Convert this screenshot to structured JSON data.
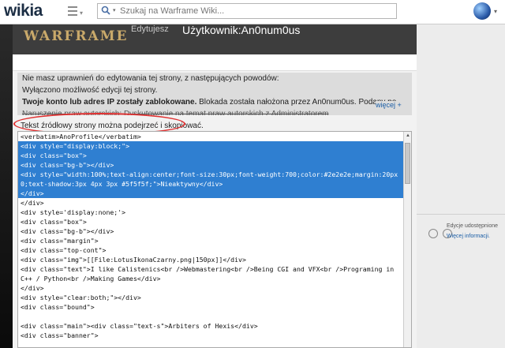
{
  "topbar": {
    "logo": "wikia",
    "search_placeholder": "Szukaj na Warframe Wiki..."
  },
  "header": {
    "site_logo": "WARFRAME",
    "editing_label": "Edytujesz",
    "page_title": "Użytkownik:An0num0us"
  },
  "notice": {
    "line1": "Nie masz uprawnień do edytowania tej strony, z następujących powodów:",
    "line2": "Wyłączono możliwość edycji tej strony.",
    "line3_bold": "Twoje konto lub adres IP zostały zablokowane.",
    "line3_rest": " Blokada została nałożona przez An0num0us. Podany po",
    "line4": "Naruszenie praw autorskich: Dyskutowanie na temat praw autorskich z Administratorem",
    "more_link": "więcej +"
  },
  "source_label": "Tekst źródłowy strony można podejrzeć i skopiować.",
  "code_lines": [
    {
      "text": "<verbatim>AnoProfile</verbatim>",
      "sel": false
    },
    {
      "text": "<div style=\"display:block;\">",
      "sel": true
    },
    {
      "text": "<div class=\"box\">",
      "sel": true
    },
    {
      "text": "<div class=\"bg-b\"></div>",
      "sel": true
    },
    {
      "text": "<div style=\"width:100%;text-align:center;font-size:30px;font-weight:700;color:#2e2e2e;margin:20px",
      "sel": true
    },
    {
      "text": "0;text-shadow:3px 4px 3px #5f5f5f;\">Nieaktywny</div>",
      "sel": true
    },
    {
      "text": "</div>",
      "sel": true
    },
    {
      "text": "</div>",
      "sel": false
    },
    {
      "text": "<div style='display:none;'>",
      "sel": false
    },
    {
      "text": "<div class=\"box\">",
      "sel": false
    },
    {
      "text": "<div class=\"bg-b\"></div>",
      "sel": false
    },
    {
      "text": "<div class=\"margin\">",
      "sel": false
    },
    {
      "text": "<div class=\"top-cont\">",
      "sel": false
    },
    {
      "text": "<div class=\"img\">[[File:LotusIkonaCzarny.png|150px]]</div>",
      "sel": false
    },
    {
      "text": "<div class=\"text\">I like Calistenics<br />Webmastering<br />Being CGI and VFX<br />Programing in",
      "sel": false
    },
    {
      "text": "C++ / Python<br />Making Games</div>",
      "sel": false
    },
    {
      "text": "</div>",
      "sel": false
    },
    {
      "text": "<div style=\"clear:both;\"></div>",
      "sel": false
    },
    {
      "text": "<div class=\"bound\">",
      "sel": false
    },
    {
      "text": "",
      "sel": false
    },
    {
      "text": "<div class=\"main\"><div class=\"text-s\">Arbiters of Hexis</div>",
      "sel": false
    },
    {
      "text": "<div class=\"banner\">",
      "sel": false
    }
  ],
  "rail": {
    "license_text": "Edycje udostępnione",
    "license_link": "Więcej informacji."
  },
  "icons": {
    "search": "search-icon",
    "menu": "hamburger-menu-icon",
    "avatar": "user-avatar-icon"
  }
}
